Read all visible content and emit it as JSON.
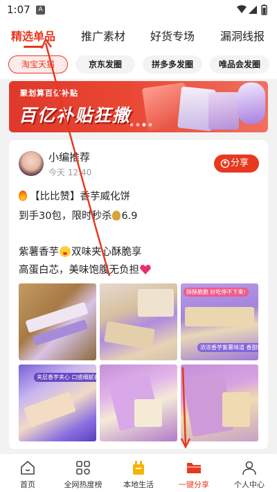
{
  "status": {
    "time": "1:07",
    "notification_letter": "A"
  },
  "top_tabs": [
    {
      "label": "精选单品",
      "active": true
    },
    {
      "label": "推广素材",
      "active": false
    },
    {
      "label": "好货专场",
      "active": false
    },
    {
      "label": "漏洞线报",
      "active": false
    }
  ],
  "platform_pills": [
    {
      "label": "淘宝天猫",
      "active": true
    },
    {
      "label": "京东发圈",
      "active": false
    },
    {
      "label": "拼多多发圈",
      "active": false
    },
    {
      "label": "唯品会发圈",
      "active": false
    }
  ],
  "banner": {
    "subtitle": "聚划算百亿补贴",
    "title": "百亿补贴狂撒"
  },
  "post": {
    "author": "小编推荐",
    "time": "今天 12:40",
    "share_label": "分享",
    "line1": "【比比赞】香芋威化饼",
    "line2_prefix": "到手30包，限时秒杀",
    "line2_price": "6.9",
    "line3": "紫薯香芋",
    "line3_suffix": "双味夹心酥脆享",
    "line4": "高蛋白芯，美味饱腹无负担",
    "photo_tag_3a": "酥酥脆脆 好吃停不下来!",
    "photo_tag_3b": "浓浓香芋紫薯味道 香甜好吃",
    "photo_tag_4": "夹层香芋夹心 口感细腻香甜"
  },
  "bottom_nav": [
    {
      "label": "首页",
      "icon": "home-icon",
      "active": false
    },
    {
      "label": "全网热度榜",
      "icon": "ranking-grid-icon",
      "active": false
    },
    {
      "label": "本地生活",
      "icon": "local-life-icon",
      "active": false
    },
    {
      "label": "一键分享",
      "icon": "folder-share-icon",
      "active": true
    },
    {
      "label": "个人中心",
      "icon": "user-icon",
      "active": false
    }
  ],
  "colors": {
    "accent": "#e8381f",
    "banner": "#e0382a"
  }
}
